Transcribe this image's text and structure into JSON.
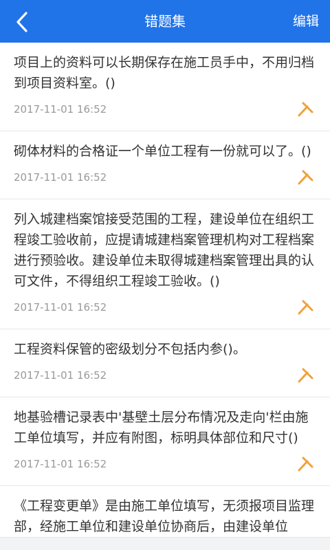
{
  "header": {
    "title": "错题集",
    "edit_label": "编辑"
  },
  "questions": [
    {
      "text": "项目上的资料可以长期保存在施工员手中，不用归档到项目资料室。()",
      "date": "2017-11-01 16:52"
    },
    {
      "text": "砌体材料的合格证一个单位工程有一份就可以了。()",
      "date": "2017-11-01 16:52"
    },
    {
      "text": "列入城建档案馆接受范围的工程，建设单位在组织工程竣工验收前，应提请城建档案管理机构对工程档案进行预验收。建设单位未取得城建档案管理出具的认可文件，不得组织工程竣工验收。()",
      "date": "2017-11-01 16:52"
    },
    {
      "text": "工程资料保管的密级划分不包括内参()。",
      "date": "2017-11-01 16:52"
    },
    {
      "text": "地基验槽记录表中'基壁土层分布情况及走向'栏由施工单位填写，并应有附图，标明具体部位和尺寸()",
      "date": "2017-11-01 16:52"
    },
    {
      "text": "《工程变更单》是由施工单位填写，无须报项目监理部，经施工单位和建设单位协商后，由建设单位",
      "date": ""
    }
  ],
  "colors": {
    "header_bg": "#2173e8",
    "pin_color": "#f0a23a"
  },
  "icons": {
    "back": "chevron-left-icon",
    "pin": "pin-icon"
  }
}
